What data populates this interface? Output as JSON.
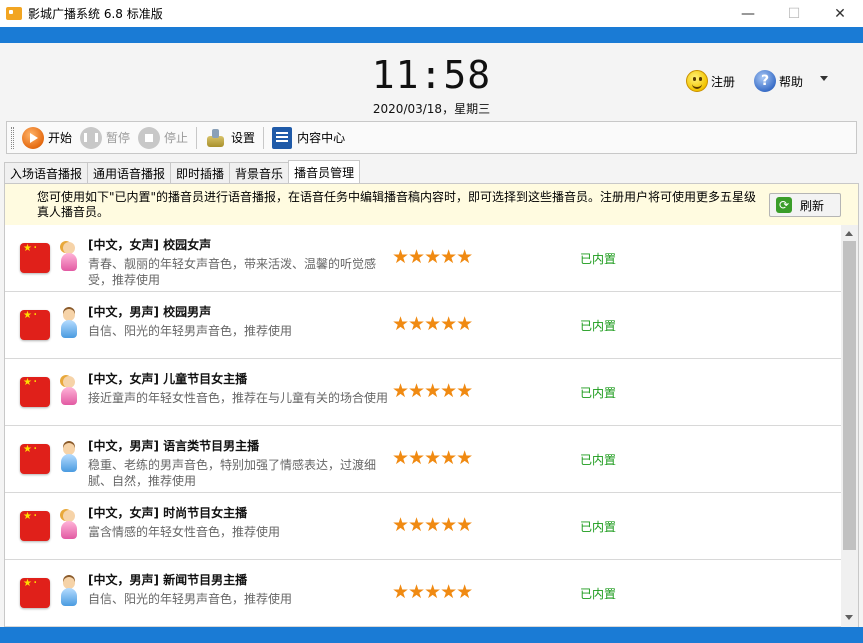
{
  "window": {
    "title": "影城广播系统 6.8 标准版",
    "controls": {
      "minimize": "—",
      "maximize": "☐",
      "close": "✕"
    }
  },
  "clock": {
    "time": "11:58",
    "date": "2020/03/18，星期三"
  },
  "header": {
    "register_label": "注册",
    "help_label": "帮助"
  },
  "toolbar": {
    "start_label": "开始",
    "pause_label": "暂停",
    "stop_label": "停止",
    "settings_label": "设置",
    "content_center_label": "内容中心"
  },
  "tabs": [
    {
      "label": "入场语音播报",
      "active": false
    },
    {
      "label": "通用语音播报",
      "active": false
    },
    {
      "label": "即时插播",
      "active": false
    },
    {
      "label": "背景音乐",
      "active": false
    },
    {
      "label": "播音员管理",
      "active": true
    }
  ],
  "notice": {
    "text": "您可使用如下\"已内置\"的播音员进行语音播报，在语音任务中编辑播音稿内容时，即可选择到这些播音员。注册用户将可使用更多五星级真人播音员。",
    "refresh_label": "刷新"
  },
  "announcers": [
    {
      "title": "[中文，女声] 校园女声",
      "desc": "青春、靓丽的年轻女声音色，带来活泼、温馨的听觉感受，推荐使用",
      "gender": "female",
      "stars": "★★★★★",
      "rating": 5,
      "status": "已内置"
    },
    {
      "title": "[中文，男声] 校园男声",
      "desc": "自信、阳光的年轻男声音色，推荐使用",
      "gender": "male",
      "stars": "★★★★★",
      "rating": 5,
      "status": "已内置"
    },
    {
      "title": "[中文，女声] 儿童节目女主播",
      "desc": "接近童声的年轻女性音色，推荐在与儿童有关的场合使用",
      "gender": "female",
      "stars": "★★★★★",
      "rating": 5,
      "status": "已内置"
    },
    {
      "title": "[中文，男声] 语言类节目男主播",
      "desc": "稳重、老练的男声音色，特别加强了情感表达，过渡细腻、自然，推荐使用",
      "gender": "male",
      "stars": "★★★★★",
      "rating": 5,
      "status": "已内置"
    },
    {
      "title": "[中文，女声] 时尚节目女主播",
      "desc": "富含情感的年轻女性音色，推荐使用",
      "gender": "female",
      "stars": "★★★★★",
      "rating": 5,
      "status": "已内置"
    },
    {
      "title": "[中文，男声] 新闻节目男主播",
      "desc": "自信、阳光的年轻男声音色，推荐使用",
      "gender": "male",
      "stars": "★★★★★",
      "rating": 5,
      "status": "已内置"
    }
  ],
  "colors": {
    "accent_blue": "#1a7bd5",
    "status_green": "#1a9a1a",
    "star_orange": "#f08a12",
    "notice_bg": "#fffbe0"
  }
}
